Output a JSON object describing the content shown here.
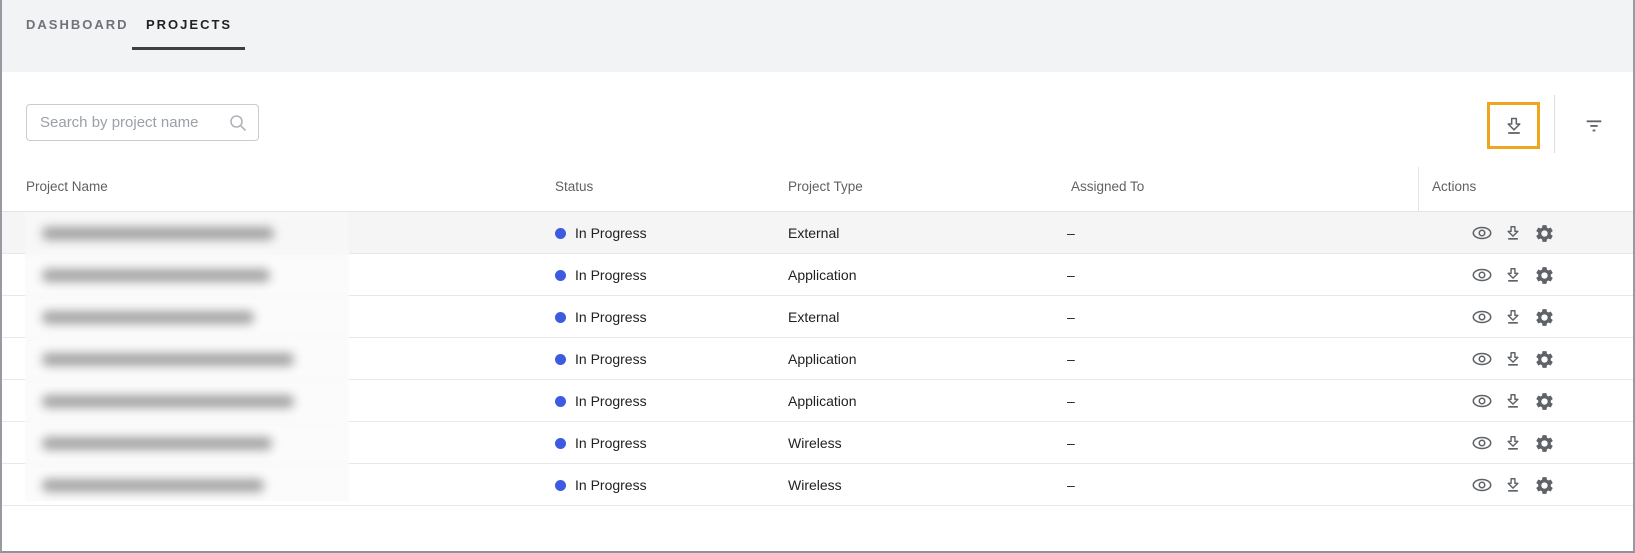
{
  "tabs": {
    "dashboard": "DASHBOARD",
    "projects": "PROJECTS",
    "active": "PROJECTS"
  },
  "toolbar": {
    "search": {
      "placeholder": "Search by project name",
      "value": "",
      "icon": "search-icon"
    },
    "download_button": {
      "icon": "download-icon",
      "highlighted": true
    },
    "filter_button": {
      "icon": "filter-list-icon"
    }
  },
  "table": {
    "columns": {
      "name": "Project Name",
      "status": "Status",
      "type": "Project Type",
      "assigned": "Assigned To",
      "actions": "Actions"
    },
    "row_action_icons": [
      "eye-icon",
      "download-icon",
      "gear-icon"
    ],
    "rows": [
      {
        "name_redacted": true,
        "status": "In Progress",
        "type": "External",
        "assigned": "–"
      },
      {
        "name_redacted": true,
        "status": "In Progress",
        "type": "Application",
        "assigned": "–"
      },
      {
        "name_redacted": true,
        "status": "In Progress",
        "type": "External",
        "assigned": "–"
      },
      {
        "name_redacted": true,
        "status": "In Progress",
        "type": "Application",
        "assigned": "–"
      },
      {
        "name_redacted": true,
        "status": "In Progress",
        "type": "Application",
        "assigned": "–"
      },
      {
        "name_redacted": true,
        "status": "In Progress",
        "type": "Wireless",
        "assigned": "–"
      },
      {
        "name_redacted": true,
        "status": "In Progress",
        "type": "Wireless",
        "assigned": "–"
      }
    ]
  },
  "colors": {
    "highlight_border": "#F0A51F",
    "status_in_progress": "#3D5BE0",
    "tabbar_bg": "#f2f3f5"
  }
}
